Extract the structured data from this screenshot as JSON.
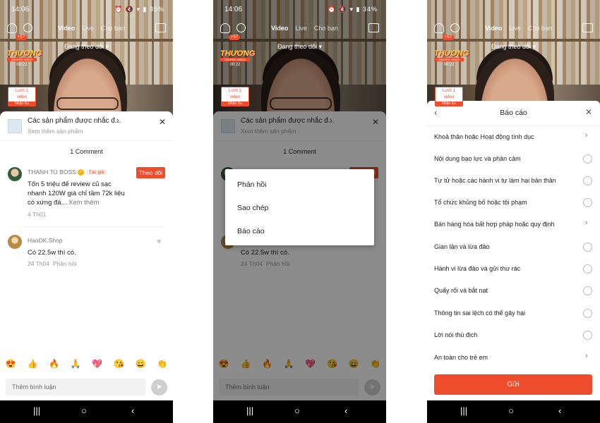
{
  "screens": [
    {
      "status": {
        "time": "14:06",
        "battery": "35%"
      }
    },
    {
      "status": {
        "time": "14:06",
        "battery": "34%"
      }
    },
    {
      "status": {
        "time": "",
        "battery": ""
      }
    }
  ],
  "top_nav": {
    "tabs": [
      "Video",
      "Live",
      "Cho bạn"
    ],
    "following": "Đang theo dõi ▾",
    "badge": "+57"
  },
  "stream_overlay": {
    "logo": "THƯƠNG",
    "logo_sub": "SHOPEE VIDEO",
    "time": "00:22",
    "promo_line1": "Lướt 1",
    "promo_line2": "video",
    "promo_action": "Nhận Xu"
  },
  "product_bar": {
    "title": "Các sản phẩm được nhắc đ...",
    "more": "Xem thêm sản phẩm"
  },
  "comments_header": "1 Comment",
  "comments": [
    {
      "user": "THANH TÚ BOSS",
      "author_tag": "Tác giả",
      "follow": "Theo dõi",
      "text_lines": [
        "Tốn 5 triệu để review củ sạc",
        "nhanh 120W giá chỉ tầm 72k liệu",
        "có xứng đá..."
      ],
      "more": "Xem thêm",
      "date": "4 Th01"
    },
    {
      "user": "HaoDK.Shop",
      "text": "Có 22.5w thì có.",
      "date": "24 Th04",
      "reply": "Phản hồi"
    }
  ],
  "emojis": [
    "😍",
    "👍",
    "🔥",
    "🙏",
    "💖",
    "😘",
    "😄",
    "👏"
  ],
  "comment_input": {
    "placeholder": "Thêm bình luận"
  },
  "context_menu": [
    "Phản hồi",
    "Sao chép",
    "Báo cáo"
  ],
  "report": {
    "title": "Báo cáo",
    "reasons": [
      {
        "label": "Khoả thân hoặc Hoạt động tình dục",
        "type": "submenu"
      },
      {
        "label": "Nội dung bạo lực và phản cảm",
        "type": "radio"
      },
      {
        "label": "Tự tử hoặc các hành vi tự làm hại bản thân",
        "type": "radio"
      },
      {
        "label": "Tổ chức khủng bố hoặc tội phạm",
        "type": "radio"
      },
      {
        "label": "Bán hàng hóa bất hợp pháp hoặc quy định",
        "type": "submenu"
      },
      {
        "label": "Gian lận và lừa đảo",
        "type": "radio"
      },
      {
        "label": "Hành vi lừa đảo và gửi thư rác",
        "type": "radio"
      },
      {
        "label": "Quấy rối và bắt nạt",
        "type": "radio"
      },
      {
        "label": "Thông tin sai lệch có thể gây hại",
        "type": "radio"
      },
      {
        "label": "Lời nói thù địch",
        "type": "radio"
      },
      {
        "label": "An toàn cho trẻ em",
        "type": "submenu"
      }
    ],
    "submit": "Gửi"
  },
  "nav_buttons": [
    "|||",
    "○",
    "‹"
  ],
  "colors": {
    "accent": "#ee4d2d"
  }
}
